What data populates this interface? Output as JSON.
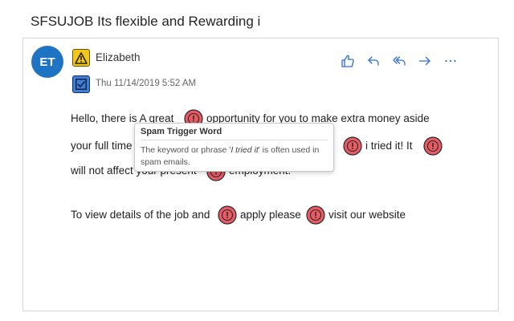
{
  "email": {
    "subject": "SFSUJOB Its flexible and Rewarding i",
    "avatar_initials": "ET",
    "sender_name": "Elizabeth",
    "datetime": "Thu 11/14/2019 5:52 AM"
  },
  "actions": [
    {
      "name": "like-icon",
      "icon": "thumbs-up"
    },
    {
      "name": "reply-icon",
      "icon": "reply"
    },
    {
      "name": "reply-all-icon",
      "icon": "reply-all"
    },
    {
      "name": "forward-icon",
      "icon": "forward"
    },
    {
      "name": "more-options-icon",
      "icon": "ellipsis"
    }
  ],
  "body": {
    "line1_a": "Hello,  there is A great",
    "line1_b": "opportunity for you to make extra money aside",
    "line2_a": "your full time",
    "line2_b": "i tried it! It",
    "line3_a": "will not affect your present",
    "line3_b": "employment.",
    "line4_a": "To view details of the job and",
    "line4_b": "apply please",
    "line4_c": "visit our website"
  },
  "tooltip": {
    "title": "Spam Trigger Word",
    "text_before": "The keyword or phrase '",
    "phrase": "I tried it",
    "text_after": "' is often used in spam emails."
  },
  "colors": {
    "avatar": "#1e73c3",
    "accent": "#2b6fd6",
    "warning": "#f4c61a",
    "spam_flag": "#e85a64"
  }
}
